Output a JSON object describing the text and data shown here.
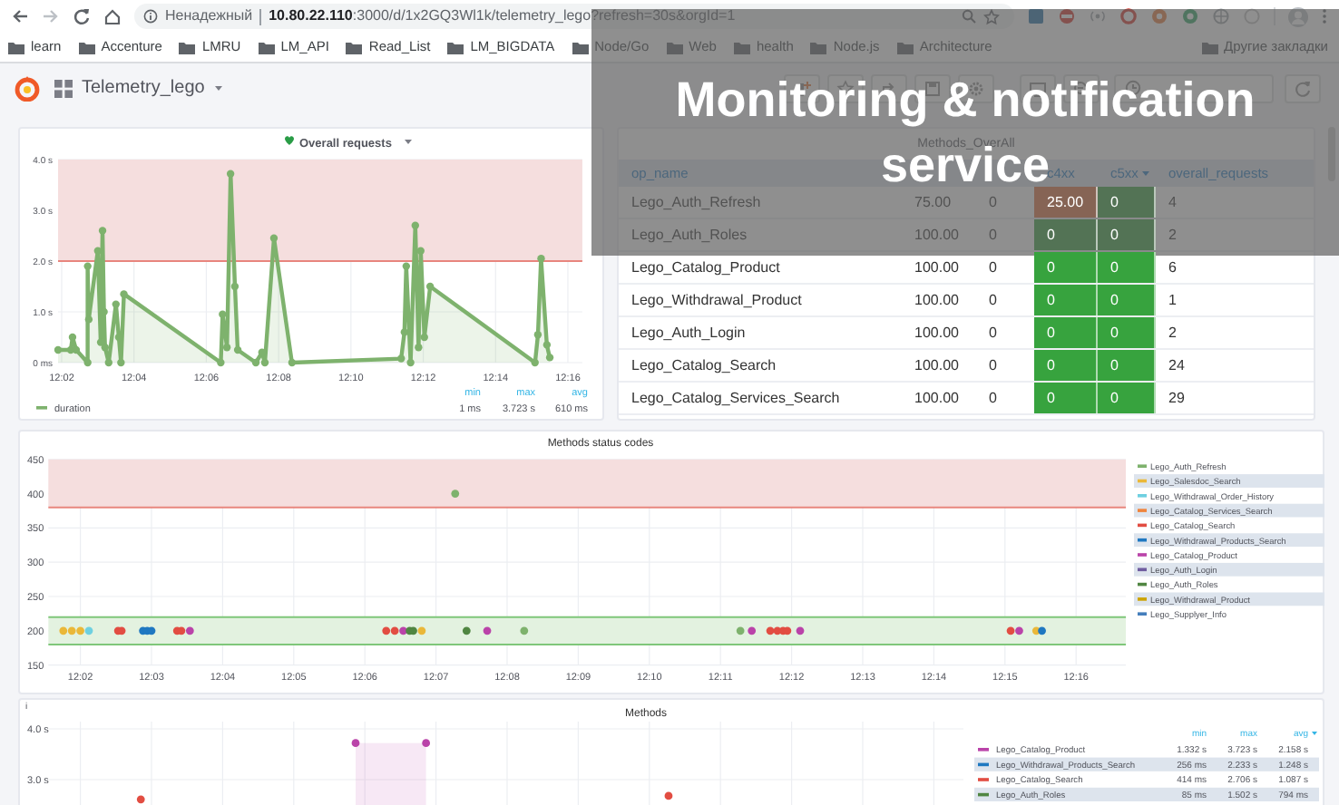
{
  "browser": {
    "security_label": "Ненадежный",
    "url": "**10.80.22.110**:3000/d/1x2GQ3Wl1k/telemetry_lego?refresh=30s&orgId=1",
    "bookmarks": [
      "learn",
      "Accenture",
      "LMRU",
      "LM_API",
      "Read_List",
      "LM_BIGDATA",
      "Node/Go",
      "Web",
      "health",
      "Node.js",
      "Architecture"
    ],
    "other_bookmarks": "Другие закладки"
  },
  "dashboard": {
    "title": "Telemetry_lego"
  },
  "caption": "Monitoring & notification service",
  "overall_requests": {
    "chart_data": {
      "type": "area",
      "title": "Overall requests",
      "grid": true,
      "x": [
        721.9,
        722.25,
        722.3,
        722.4,
        722.72,
        722.72,
        722.75,
        723.0,
        723.08,
        723.13,
        723.17,
        723.2,
        723.3,
        723.5,
        723.58,
        723.64,
        723.72,
        726.4,
        726.45,
        726.57,
        726.67,
        726.79,
        726.87,
        727.37,
        727.54,
        727.62,
        727.87,
        728.37,
        731.39,
        731.48,
        731.53,
        731.65,
        731.78,
        731.87,
        731.93,
        732.03,
        732.19,
        735.09,
        735.17,
        735.26,
        735.42,
        735.5
      ],
      "series": [
        {
          "name": "duration",
          "color": "#7eb26d",
          "marker": true,
          "values": [
            0.25,
            0.25,
            0.5,
            0.25,
            0,
            1.9,
            0.85,
            2.2,
            0.4,
            2.6,
            1.0,
            0.3,
            0,
            1.15,
            0.5,
            0,
            1.35,
            0,
            0.95,
            0.3,
            3.72,
            1.5,
            0.25,
            0,
            0.2,
            0,
            2.45,
            0,
            0.08,
            0.6,
            1.9,
            0,
            2.7,
            0.3,
            2.2,
            0.5,
            1.5,
            0,
            0.55,
            2.05,
            0.35,
            0.1
          ]
        }
      ],
      "xlim": [
        721.9,
        736.4
      ],
      "ylim": [
        0,
        4
      ],
      "xticks": [
        {
          "value": 722,
          "label": "12:02"
        },
        {
          "value": 724,
          "label": "12:04"
        },
        {
          "value": 726,
          "label": "12:06"
        },
        {
          "value": 728,
          "label": "12:08"
        },
        {
          "value": 730,
          "label": "12:10"
        },
        {
          "value": 732,
          "label": "12:12"
        },
        {
          "value": 734,
          "label": "12:14"
        },
        {
          "value": 736,
          "label": "12:16"
        }
      ],
      "yticks": [
        {
          "value": 0,
          "label": "0 ms"
        },
        {
          "value": 1,
          "label": "1.0 s"
        },
        {
          "value": 2,
          "label": "2.0 s"
        },
        {
          "value": 3,
          "label": "3.0 s"
        },
        {
          "value": 4,
          "label": "4.0 s"
        }
      ],
      "ref_lines": [
        {
          "axis": "y",
          "value": 2,
          "color": "#e8867e"
        }
      ],
      "bands": [
        {
          "axis": "y",
          "from": 2,
          "to": 4,
          "color": "#f5dede"
        }
      ]
    },
    "legend": {
      "headers": [
        "min",
        "max",
        "avg"
      ],
      "values": [
        "1 ms",
        "3.723 s",
        "610 ms"
      ]
    }
  },
  "methods_overall": {
    "title": "Methods_OverAll",
    "columns": [
      {
        "label": "op_name",
        "sorted": false
      },
      {},
      {},
      {
        "label": "c4xx",
        "sorted": false
      },
      {
        "label": "c5xx",
        "sorted": true
      },
      {
        "label": "overall_requests",
        "sorted": false
      }
    ],
    "rows": [
      {
        "op_name": "Lego_Auth_Refresh",
        "column_2": "75.00",
        "column_3": "0",
        "c4xx": {
          "text": "25.00",
          "color": "#866455"
        },
        "c5xx": {
          "text": "0",
          "color": "#537355"
        },
        "overall_requests": "4"
      },
      {
        "op_name": "Lego_Auth_Roles",
        "column_2": "100.00",
        "column_3": "0",
        "c4xx": {
          "text": "0",
          "color": "#537355"
        },
        "c5xx": {
          "text": "0",
          "color": "#537355"
        },
        "overall_requests": "2"
      },
      {
        "op_name": "Lego_Catalog_Product",
        "column_2": "100.00",
        "column_3": "0",
        "c4xx": {
          "text": "0",
          "color": "#37a33e"
        },
        "c5xx": {
          "text": "0",
          "color": "#37a33e"
        },
        "overall_requests": "6"
      },
      {
        "op_name": "Lego_Withdrawal_Product",
        "column_2": "100.00",
        "column_3": "0",
        "c4xx": {
          "text": "0",
          "color": "#37a33e"
        },
        "c5xx": {
          "text": "0",
          "color": "#37a33e"
        },
        "overall_requests": "1"
      },
      {
        "op_name": "Lego_Auth_Login",
        "column_2": "100.00",
        "column_3": "0",
        "c4xx": {
          "text": "0",
          "color": "#37a33e"
        },
        "c5xx": {
          "text": "0",
          "color": "#37a33e"
        },
        "overall_requests": "2"
      },
      {
        "op_name": "Lego_Catalog_Search",
        "column_2": "100.00",
        "column_3": "0",
        "c4xx": {
          "text": "0",
          "color": "#37a33e"
        },
        "c5xx": {
          "text": "0",
          "color": "#37a33e"
        },
        "overall_requests": "24"
      },
      {
        "op_name": "Lego_Catalog_Services_Search",
        "column_2": "100.00",
        "column_3": "0",
        "c4xx": {
          "text": "0",
          "color": "#37a33e"
        },
        "c5xx": {
          "text": "0",
          "color": "#37a33e"
        },
        "overall_requests": "29"
      }
    ]
  },
  "status_codes": {
    "chart_data": {
      "type": "scatter",
      "title": "Methods status codes",
      "grid": true,
      "legend": "right",
      "x": [
        721.76,
        721.88,
        722.0,
        722.12,
        722.53,
        722.58,
        722.88,
        722.94,
        723.0,
        723.36,
        723.42,
        723.54,
        726.3,
        726.42,
        726.54,
        726.63,
        726.68,
        726.8,
        727.27,
        727.43,
        727.72,
        728.24,
        731.28,
        731.44,
        731.7,
        731.8,
        731.88,
        731.94,
        732.12,
        735.08,
        735.2,
        735.44,
        735.52
      ],
      "xlim": [
        721.55,
        736.7
      ],
      "ylim": [
        150,
        450
      ],
      "xticks": [
        {
          "value": 722,
          "label": "12:02"
        },
        {
          "value": 723,
          "label": "12:03"
        },
        {
          "value": 724,
          "label": "12:04"
        },
        {
          "value": 725,
          "label": "12:05"
        },
        {
          "value": 726,
          "label": "12:06"
        },
        {
          "value": 727,
          "label": "12:07"
        },
        {
          "value": 728,
          "label": "12:08"
        },
        {
          "value": 729,
          "label": "12:09"
        },
        {
          "value": 730,
          "label": "12:10"
        },
        {
          "value": 731,
          "label": "12:11"
        },
        {
          "value": 732,
          "label": "12:12"
        },
        {
          "value": 733,
          "label": "12:13"
        },
        {
          "value": 734,
          "label": "12:14"
        },
        {
          "value": 735,
          "label": "12:15"
        },
        {
          "value": 736,
          "label": "12:16"
        }
      ],
      "yticks": [
        150,
        200,
        250,
        300,
        350,
        400,
        450
      ],
      "ref_lines": [
        {
          "axis": "y",
          "value": 380,
          "color": "#e8867e"
        },
        {
          "axis": "y",
          "value": 220,
          "color": "#7fc77a"
        },
        {
          "axis": "y",
          "value": 180,
          "color": "#7fc77a"
        }
      ],
      "bands": [
        {
          "axis": "y",
          "from": 380,
          "to": 450,
          "color": "#f5dede"
        },
        {
          "axis": "y",
          "from": 180,
          "to": 220,
          "color": "#e3f2e0"
        }
      ],
      "series": [
        {
          "name": "Lego_Auth_Refresh",
          "color": "#7eb26d",
          "values": [
            null,
            null,
            null,
            null,
            null,
            null,
            null,
            null,
            null,
            null,
            null,
            null,
            null,
            null,
            null,
            null,
            null,
            null,
            400,
            null,
            null,
            200,
            200,
            null,
            null,
            null,
            null,
            null,
            null,
            null,
            null,
            null,
            null
          ]
        },
        {
          "name": "Lego_Salesdoc_Search",
          "color": "#eab839",
          "values": [
            200,
            200,
            200,
            null,
            null,
            null,
            null,
            null,
            null,
            null,
            null,
            null,
            null,
            null,
            null,
            null,
            null,
            200,
            null,
            null,
            null,
            null,
            null,
            null,
            null,
            null,
            null,
            null,
            null,
            null,
            null,
            200,
            null
          ]
        },
        {
          "name": "Lego_Withdrawal_Order_History",
          "color": "#6ed0e0",
          "values": [
            null,
            null,
            null,
            200,
            null,
            null,
            null,
            null,
            null,
            null,
            null,
            null,
            null,
            null,
            null,
            null,
            null,
            null,
            null,
            null,
            null,
            null,
            null,
            null,
            null,
            null,
            null,
            null,
            null,
            null,
            null,
            null,
            null
          ]
        },
        {
          "name": "Lego_Catalog_Services_Search",
          "color": "#ef843c",
          "values": [
            null,
            null,
            null,
            null,
            null,
            null,
            null,
            null,
            null,
            null,
            null,
            null,
            null,
            null,
            null,
            null,
            null,
            null,
            null,
            null,
            null,
            null,
            null,
            null,
            null,
            null,
            null,
            null,
            null,
            null,
            null,
            null,
            null
          ]
        },
        {
          "name": "Lego_Catalog_Search",
          "color": "#e24d42",
          "values": [
            null,
            null,
            null,
            null,
            200,
            200,
            null,
            null,
            null,
            200,
            200,
            null,
            200,
            200,
            null,
            null,
            null,
            null,
            null,
            null,
            null,
            null,
            null,
            null,
            200,
            200,
            200,
            200,
            null,
            200,
            null,
            null,
            null
          ]
        },
        {
          "name": "Lego_Withdrawal_Products_Search",
          "color": "#1f78c1",
          "values": [
            null,
            null,
            null,
            null,
            null,
            null,
            200,
            200,
            200,
            null,
            null,
            null,
            null,
            null,
            null,
            null,
            null,
            null,
            null,
            null,
            null,
            null,
            null,
            null,
            null,
            null,
            null,
            null,
            null,
            null,
            null,
            null,
            200
          ]
        },
        {
          "name": "Lego_Catalog_Product",
          "color": "#ba43a9",
          "values": [
            null,
            null,
            null,
            null,
            null,
            null,
            null,
            null,
            null,
            null,
            null,
            200,
            null,
            null,
            200,
            null,
            null,
            null,
            null,
            null,
            200,
            null,
            null,
            200,
            null,
            null,
            null,
            null,
            200,
            null,
            200,
            null,
            null
          ]
        },
        {
          "name": "Lego_Auth_Login",
          "color": "#705da0",
          "values": [
            null,
            null,
            null,
            null,
            null,
            null,
            null,
            null,
            null,
            null,
            null,
            null,
            null,
            null,
            null,
            null,
            null,
            null,
            null,
            null,
            null,
            null,
            null,
            null,
            null,
            null,
            null,
            null,
            null,
            null,
            null,
            null,
            null
          ]
        },
        {
          "name": "Lego_Auth_Roles",
          "color": "#508642",
          "values": [
            null,
            null,
            null,
            null,
            null,
            null,
            null,
            null,
            null,
            null,
            null,
            null,
            null,
            null,
            null,
            200,
            200,
            null,
            null,
            200,
            null,
            null,
            null,
            null,
            null,
            null,
            null,
            null,
            null,
            null,
            null,
            null,
            null
          ]
        },
        {
          "name": "Lego_Withdrawal_Product",
          "color": "#cca300",
          "values": [
            null,
            null,
            null,
            null,
            null,
            null,
            null,
            null,
            null,
            null,
            null,
            null,
            null,
            null,
            null,
            null,
            null,
            null,
            null,
            null,
            null,
            null,
            null,
            null,
            null,
            null,
            null,
            null,
            null,
            null,
            null,
            null,
            null
          ]
        },
        {
          "name": "Lego_Supplyer_Info",
          "color": "#447ebc",
          "values": [
            null,
            null,
            null,
            null,
            null,
            null,
            null,
            null,
            null,
            null,
            null,
            null,
            null,
            null,
            null,
            null,
            null,
            null,
            null,
            null,
            null,
            null,
            null,
            null,
            null,
            null,
            null,
            null,
            null,
            null,
            null,
            null,
            null
          ]
        }
      ]
    }
  },
  "methods": {
    "info": "i",
    "title": "Methods",
    "y_axis_labels": [
      "4.0 s",
      "3.0 s"
    ],
    "legend": {
      "headers": [
        {
          "label": "min",
          "sorted": false
        },
        {
          "label": "max",
          "sorted": false
        },
        {
          "label": "avg",
          "sorted": true
        }
      ],
      "rows": [
        {
          "name": "Lego_Catalog_Product",
          "color": "#ba43a9",
          "values": [
            "1.332 s",
            "3.723 s",
            "2.158 s"
          ]
        },
        {
          "name": "Lego_Withdrawal_Products_Search",
          "color": "#1f78c1",
          "values": [
            "256 ms",
            "2.233 s",
            "1.248 s"
          ]
        },
        {
          "name": "Lego_Catalog_Search",
          "color": "#e24d42",
          "values": [
            "414 ms",
            "2.706 s",
            "1.087 s"
          ]
        },
        {
          "name": "Lego_Auth_Roles",
          "color": "#508642",
          "values": [
            "85 ms",
            "1.502 s",
            "794 ms"
          ]
        }
      ]
    }
  }
}
